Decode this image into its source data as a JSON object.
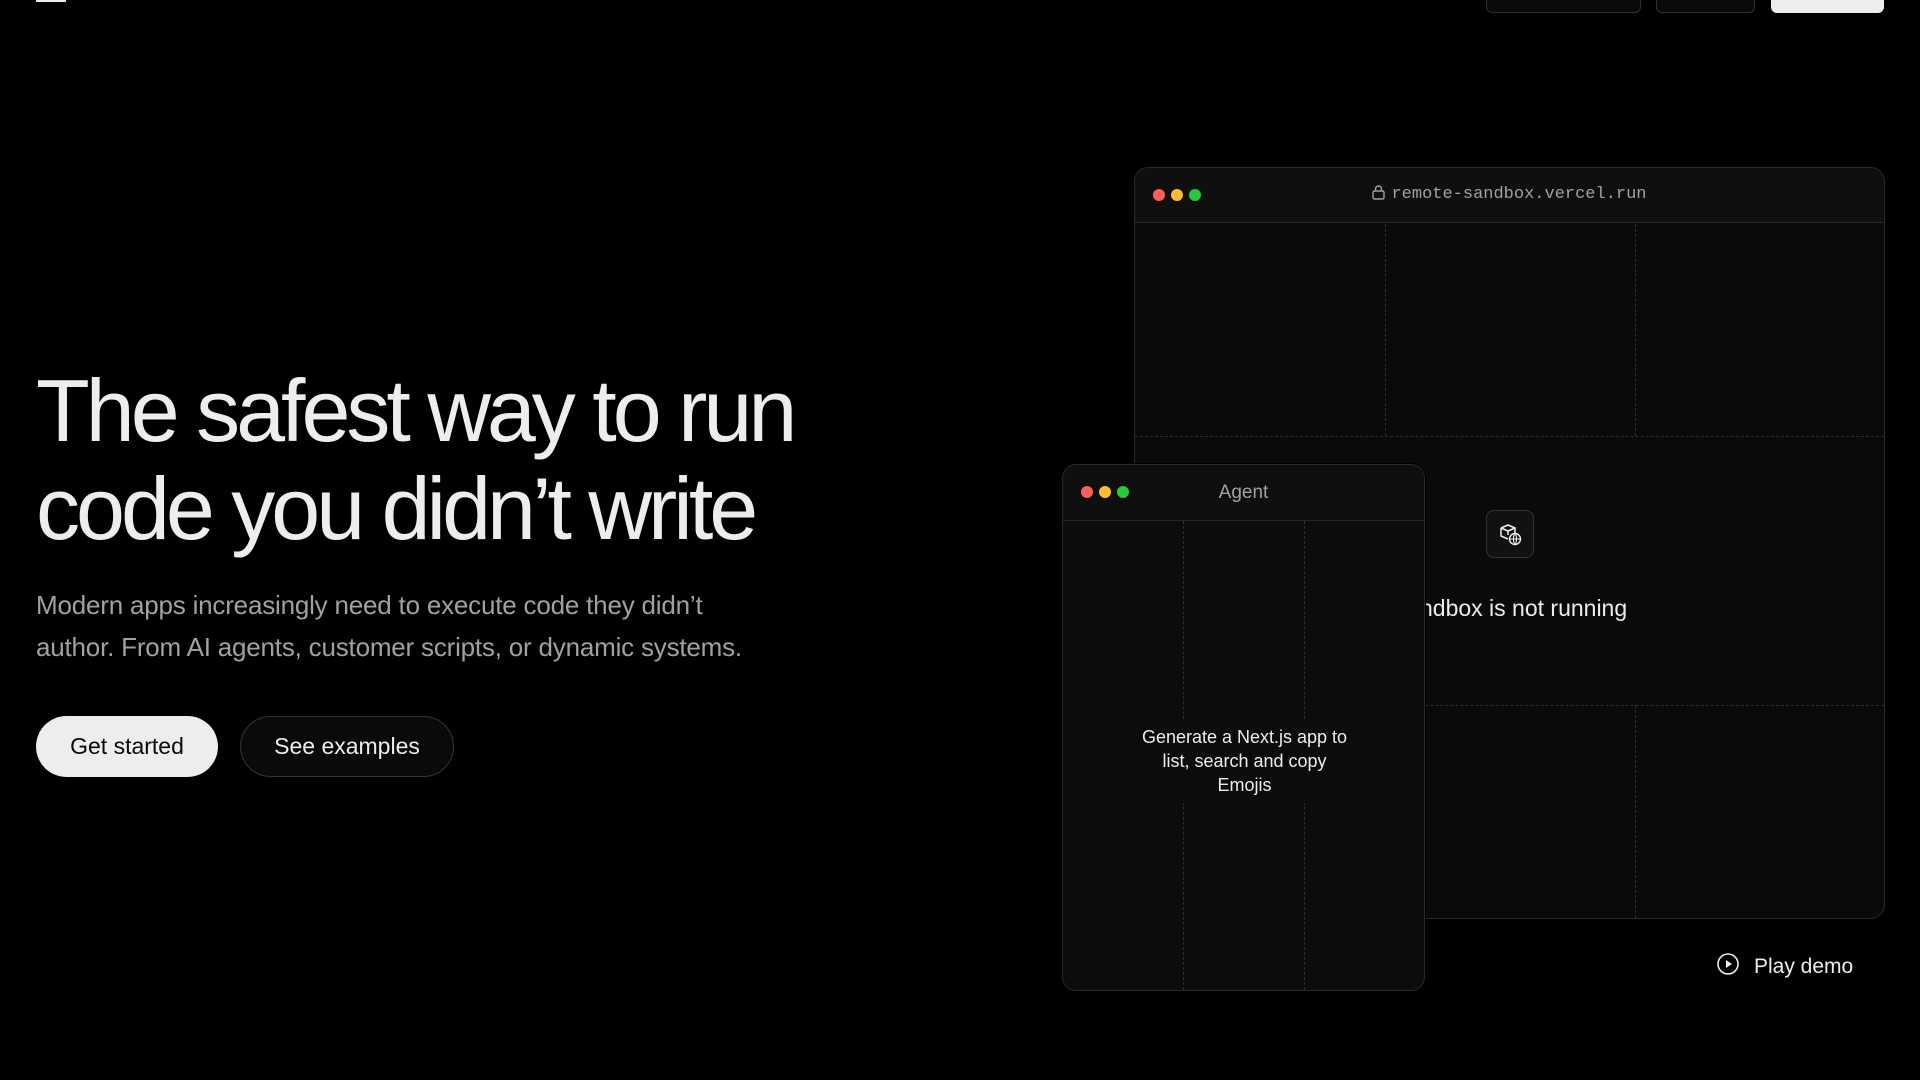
{
  "hero": {
    "title_line1": "The safest way to run",
    "title_line2": "code you didn’t write",
    "subtitle_line1": "Modern apps increasingly need to execute code they didn’t",
    "subtitle_line2": "author. From AI agents, customer scripts, or dynamic systems.",
    "cta_primary": "Get started",
    "cta_secondary": "See examples"
  },
  "sandbox_window": {
    "url": "remote-sandbox.vercel.run",
    "status": "Sandbox is not running",
    "icon": "box-globe-icon"
  },
  "agent_window": {
    "title": "Agent",
    "prompt": "Generate a Next.js app to list, search and copy Emojis"
  },
  "demo": {
    "label": "Play demo",
    "icon": "play-circle-icon"
  },
  "colors": {
    "background": "#000000",
    "text": "#ededed",
    "muted": "#a1a1a1",
    "dot_red": "#ff5f57",
    "dot_yellow": "#febc2e",
    "dot_green": "#28c840"
  }
}
